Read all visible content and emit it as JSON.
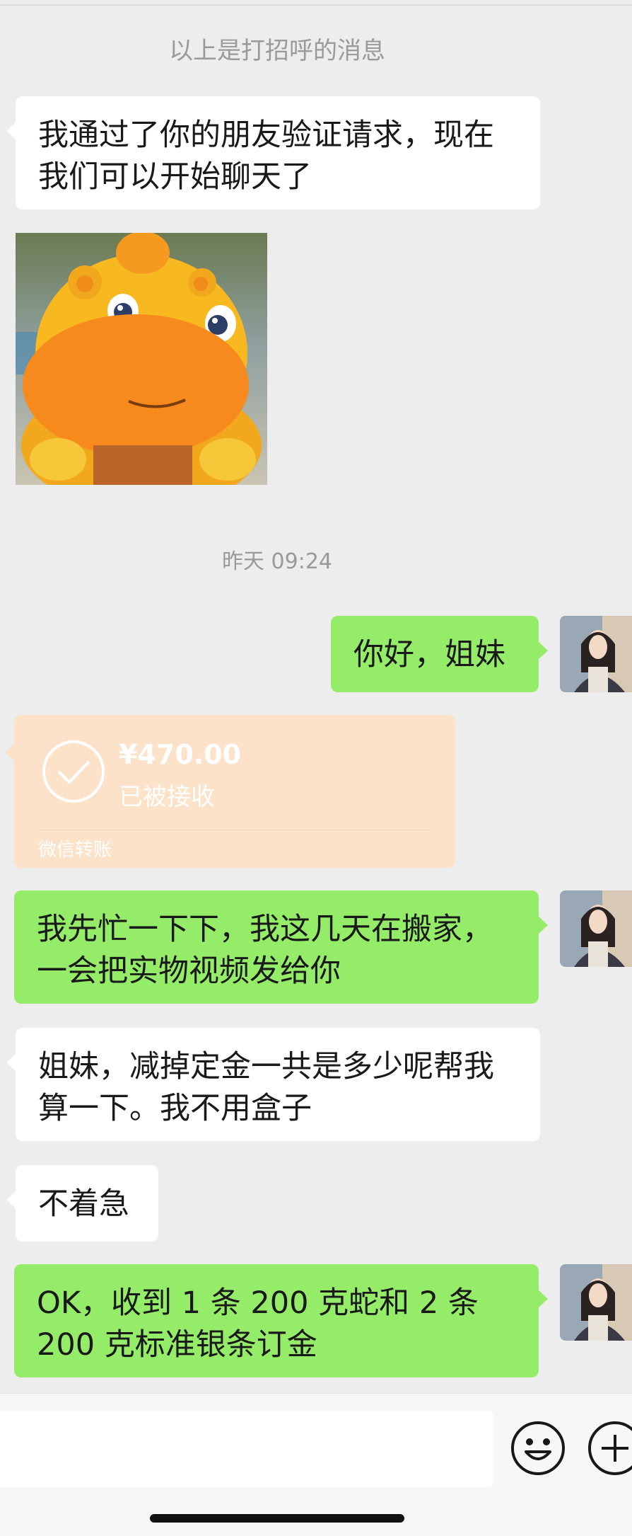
{
  "system_note": "以上是打招呼的消息",
  "timestamp": "昨天 09:24",
  "messages": {
    "greet_verified": "我通过了你的朋友验证请求，现在我们可以开始聊天了",
    "hello": "你好，姐妹",
    "busy_moving": "我先忙一下下，我这几天在搬家，一会把实物视频发给你",
    "deposit_question": "姐妹，减掉定金一共是多少呢帮我算一下。我不用盒子",
    "no_rush": "不着急",
    "ok_received": "OK，收到 1 条 200 克蛇和 2 条 200 克标准银条订金"
  },
  "transfer": {
    "amount": "¥470.00",
    "status": "已被接收",
    "label": "微信转账"
  },
  "input": {
    "value": ""
  },
  "icons": {
    "emoji": "emoji-icon",
    "plus": "plus-icon",
    "check": "check-circle-icon"
  },
  "colors": {
    "background": "#ededed",
    "incoming_bubble": "#ffffff",
    "outgoing_bubble": "#95ec69",
    "transfer_card": "#fbe2c9"
  }
}
